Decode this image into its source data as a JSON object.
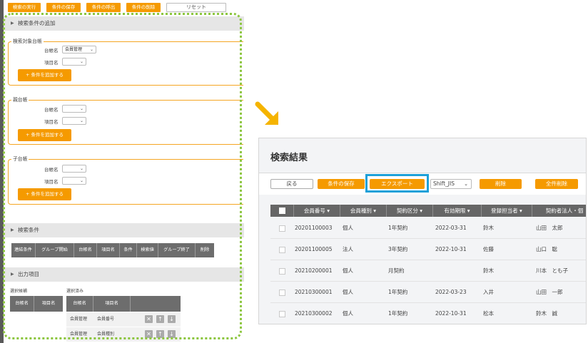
{
  "top_buttons": [
    "検索の実行",
    "条件の保存",
    "条件の呼出",
    "条件の削除",
    "リセット"
  ],
  "sections": {
    "add_condition": "検索条件の追加",
    "search_condition": "検索条件",
    "output_items": "出力項目"
  },
  "groups": [
    {
      "title": "検索対象台帳",
      "ledger_label": "台帳名",
      "ledger_value": "会員管理",
      "item_label": "項目名",
      "item_value": "",
      "add_button": "+ 条件を追加する"
    },
    {
      "title": "親台帳",
      "ledger_label": "台帳名",
      "ledger_value": "",
      "item_label": "項目名",
      "item_value": "",
      "add_button": "+ 条件を追加する"
    },
    {
      "title": "子台帳",
      "ledger_label": "台帳名",
      "ledger_value": "",
      "item_label": "項目名",
      "item_value": "",
      "add_button": "+ 条件を追加する"
    }
  ],
  "condition_table_headers": [
    "連結条件",
    "グループ開始",
    "台帳名",
    "項目名",
    "条件",
    "検索値",
    "グループ終了",
    "削除"
  ],
  "output": {
    "candidates_label": "選択候補",
    "selected_label": "選択済み",
    "candidate_headers": [
      "台帳名",
      "項目名"
    ],
    "selected_headers": [
      "台帳名",
      "項目名"
    ],
    "selected_rows": [
      {
        "ledger": "会員管理",
        "item": "会員番号"
      },
      {
        "ledger": "会員管理",
        "item": "会員種別"
      }
    ]
  },
  "icons": {
    "delete": "close-icon",
    "up": "arrow-up-icon",
    "down": "arrow-down-icon",
    "chevron": "chevron-down-icon"
  },
  "colors": {
    "accent_orange": "#f59a00",
    "highlight_blue": "#1ca0d8",
    "dotted_green": "#8cc63f",
    "arrow_yellow": "#f5b400"
  },
  "results": {
    "title": "検索結果",
    "buttons": {
      "back": "戻る",
      "save": "条件の保存",
      "export": "エクスポート",
      "delete": "削除",
      "delete_all": "全件削除"
    },
    "encoding": "Shift_JIS",
    "columns": [
      "会員番号 ▾",
      "会員種別 ▾",
      "契約区分 ▾",
      "有効期限 ▾",
      "登録担当者 ▾",
      "契約者法人・個"
    ],
    "rows": [
      [
        "20201100003",
        "個人",
        "1年契約",
        "2022-03-31",
        "鈴木",
        "山田　太郎"
      ],
      [
        "20201100005",
        "法人",
        "3年契約",
        "2022-10-31",
        "佐藤",
        "山口　聡"
      ],
      [
        "20210200001",
        "個人",
        "月契約",
        "",
        "鈴木",
        "川本　とも子"
      ],
      [
        "20210300001",
        "個人",
        "1年契約",
        "2022-03-23",
        "入井",
        "山田　一郎"
      ],
      [
        "20210300002",
        "個人",
        "1年契約",
        "2022-10-31",
        "松本",
        "鈴木　誠"
      ]
    ]
  }
}
